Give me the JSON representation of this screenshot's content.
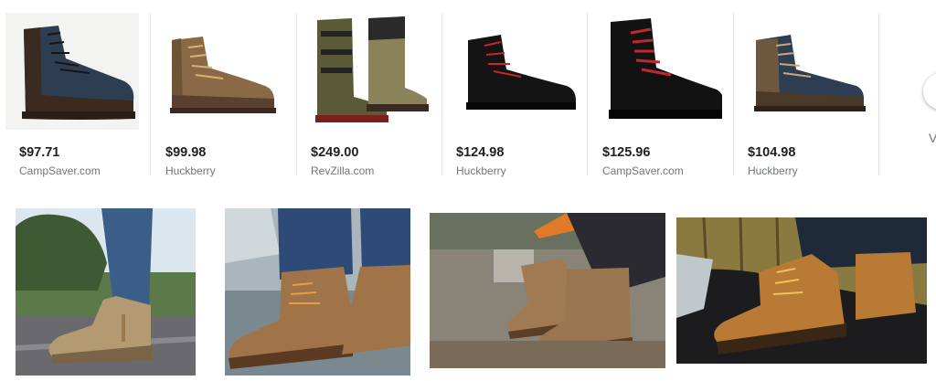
{
  "shopping": {
    "products": [
      {
        "price": "$97.71",
        "merchant": "CampSaver.com",
        "icon": "navy-leather-boot"
      },
      {
        "price": "$99.98",
        "merchant": "Huckberry",
        "icon": "brown-suede-boot"
      },
      {
        "price": "$249.00",
        "merchant": "RevZilla.com",
        "icon": "motorcycle-boots"
      },
      {
        "price": "$124.98",
        "merchant": "Huckberry",
        "icon": "black-red-lace-boot"
      },
      {
        "price": "$125.96",
        "merchant": "CampSaver.com",
        "icon": "black-red-lace-boot"
      },
      {
        "price": "$104.98",
        "merchant": "Huckberry",
        "icon": "navy-brown-boot"
      }
    ],
    "view_more_label": "V"
  },
  "photos": [
    {
      "icon": "boots-on-road-photo"
    },
    {
      "icon": "boots-by-river-photo"
    },
    {
      "icon": "boots-on-campsite-photo"
    },
    {
      "icon": "boots-on-car-roof-photo"
    }
  ],
  "colors": {
    "price": "#202124",
    "merchant": "#70757a",
    "divider": "#e4e4e4"
  }
}
